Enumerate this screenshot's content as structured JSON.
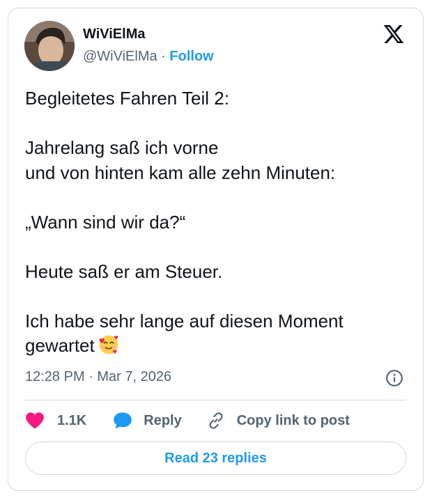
{
  "author": {
    "name": "WiViElMa",
    "handle": "@WiViElMa",
    "separator": "·",
    "follow_label": "Follow"
  },
  "logo": {
    "icon": "x-logo-icon"
  },
  "tweet": {
    "lines": [
      "Begleitetes Fahren Teil 2:",
      "Jahrelang saß ich vorne",
      "und von hinten kam alle zehn Minuten:",
      "„Wann sind wir da?“",
      "Heute saß er am Steuer.",
      "Ich habe sehr lange auf diesen Moment",
      "gewartet"
    ],
    "emoji": "smiling-face-with-hearts"
  },
  "meta": {
    "timestamp": "12:28 PM · Mar 7, 2026"
  },
  "actions": {
    "likes_count": "1.1K",
    "reply_label": "Reply",
    "copy_link_label": "Copy link to post"
  },
  "read_replies_label": "Read 23 replies",
  "colors": {
    "accent": "#1d9bf0",
    "like": "#f91880",
    "text": "#0f1419",
    "secondary": "#536471",
    "border": "#cfd9de"
  }
}
